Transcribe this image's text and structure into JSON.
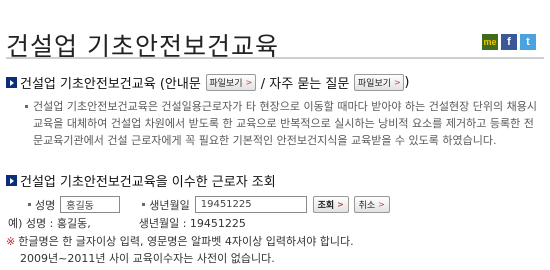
{
  "page_title": "건설업 기초안전보건교육",
  "share_icons": [
    "me2day-icon",
    "facebook-icon",
    "twitter-icon"
  ],
  "section1": {
    "title_part1": "건설업 기초안전보건교육 (안내문",
    "title_part2": "/ 자주 묻는 질문",
    "title_part3": ")",
    "file_button_label": "파일보기",
    "description": "건설업 기초안전보건교육은 건설일용근로자가 타 현장으로 이동할 때마다 받아야 하는 건설현장 단위의 채용시 교육을 대체하여 건설업 차원에서 받도록 한 교육으로 반복적으로 실시하는 낭비적 요소를 제거하고 등록한 전문교육기관에서 건설 근로자에게 꼭 필요한 기본적인 안전보건지식을 교육받을 수 있도록 하였습니다."
  },
  "section2": {
    "title": "건설업 기초안전보건교육을 이수한 근로자 조회",
    "name_label": "성명",
    "name_value": "홍길동",
    "birth_label": "생년월일",
    "birth_value": "19451225",
    "search_button": "조회",
    "cancel_button": "취소"
  },
  "example": {
    "prefix": "예) 성명 : 홍길동,",
    "birth": "생년월일 :  19451225"
  },
  "notes": {
    "star": "※",
    "line1": "한글명은 한 글자이상 입력, 영문명은 알파벳 4자이상 입력하셔야 합니다.",
    "line2": "2009년~2011년 사이 교육이수자는 사전이 없습니다."
  }
}
